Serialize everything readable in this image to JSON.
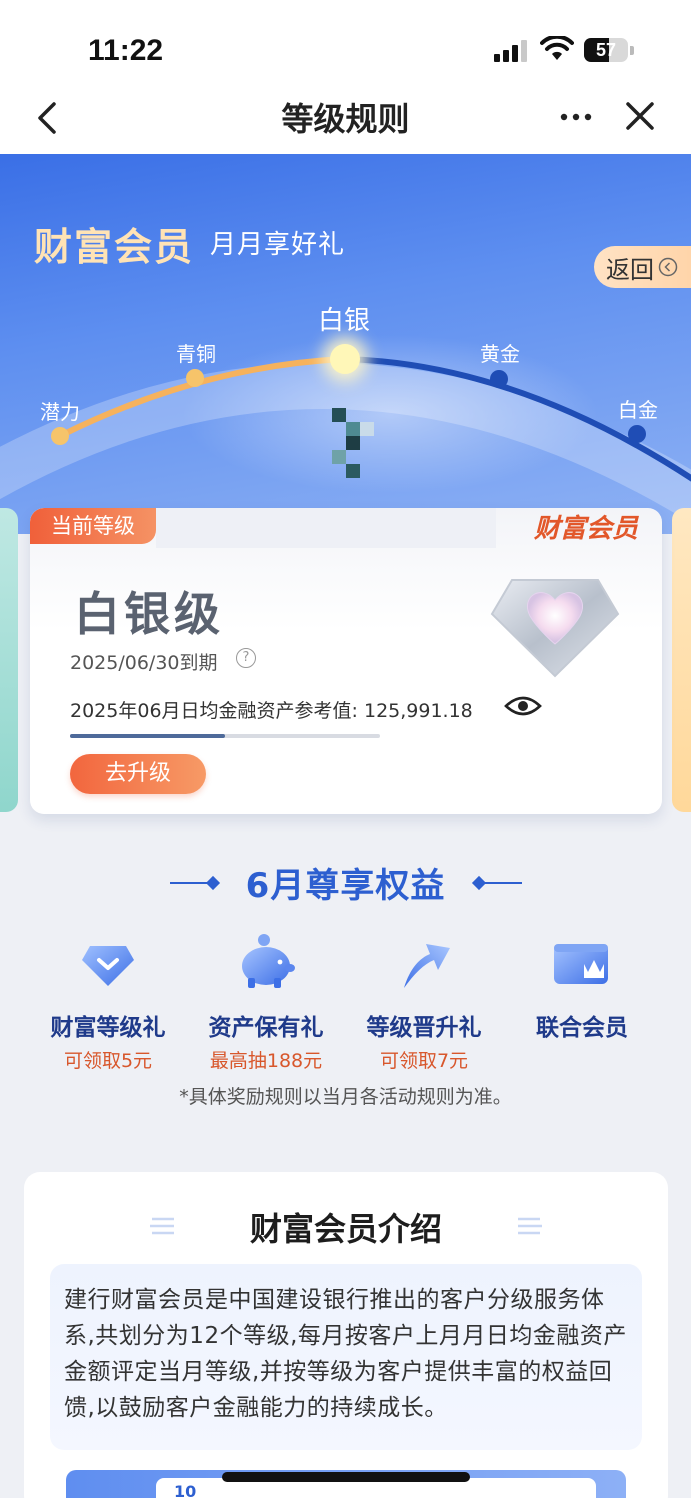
{
  "status_bar": {
    "time": "11:22",
    "battery": "57",
    "battery_level": 0.57
  },
  "nav": {
    "title": "等级规则"
  },
  "hero": {
    "title": "财富会员",
    "subtitle": "月月享好礼",
    "back_label": "返回",
    "levels": [
      {
        "name": "潜力",
        "reached": true
      },
      {
        "name": "青铜",
        "reached": true
      },
      {
        "name": "白银",
        "reached": true,
        "current": true
      },
      {
        "name": "黄金",
        "reached": false
      },
      {
        "name": "白金",
        "reached": false
      }
    ]
  },
  "level_card": {
    "tab_label": "当前等级",
    "brand": "财富会员",
    "level_title": "白银级",
    "expiry": "2025/06/30到期",
    "asset_label": "2025年06月日均金融资产参考值:",
    "asset_value": "125,991.18",
    "progress": 0.5,
    "upgrade_button": "去升级"
  },
  "benefits": {
    "title": "6月尊享权益",
    "items": [
      {
        "name": "财富等级礼",
        "sub": "可领取5元",
        "icon": "diamond-badge-icon"
      },
      {
        "name": "资产保有礼",
        "sub": "最高抽188元",
        "icon": "piggy-bank-icon"
      },
      {
        "name": "等级晋升礼",
        "sub": "可领取7元",
        "icon": "up-arrow-icon"
      },
      {
        "name": "联合会员",
        "sub": "",
        "icon": "crown-card-icon"
      }
    ],
    "note": "*具体奖励规则以当月各活动规则为准。"
  },
  "intro": {
    "title": "财富会员介绍",
    "body": "建行财富会员是中国建设银行推出的客户分级服务体系,共划分为12个等级,每月按客户上月月日均金融资产金额评定当月等级,并按等级为客户提供丰富的权益回馈,以鼓励客户金融能力的持续成长。",
    "preview_number": "10"
  },
  "colors": {
    "accent_blue": "#2d5fd0",
    "accent_orange": "#f2663e",
    "reached_level": "#f6c46a",
    "unreached_level": "#1f4db5"
  }
}
